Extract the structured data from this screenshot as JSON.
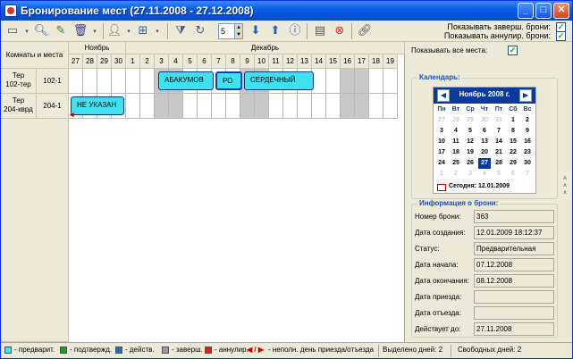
{
  "window": {
    "title": "Бронирование мест (27.11.2008 - 27.12.2008)"
  },
  "titlebar_buttons": {
    "minimize": "_",
    "maximize": "□",
    "close": "✕"
  },
  "toolbar": {
    "spin_value": "5",
    "options": {
      "show_completed": "Показывать заверш. брони:",
      "show_cancelled": "Показывать аннулир. брони:"
    }
  },
  "grid": {
    "rooms_header": "Комнаты и места",
    "months": [
      "Ноябрь",
      "Декабрь"
    ],
    "days": [
      "27",
      "28",
      "29",
      "30",
      "1",
      "2",
      "3",
      "4",
      "5",
      "6",
      "7",
      "8",
      "9",
      "10",
      "11",
      "12",
      "13",
      "14",
      "15",
      "16",
      "17",
      "18",
      "19"
    ],
    "rows": [
      {
        "room": "Тер\n102-тер",
        "place": "102-1"
      },
      {
        "room": "Тер\n204-кврд",
        "place": "204-1"
      }
    ],
    "bookings": [
      "АБАКУМОВ",
      "РО",
      "СЕРДЕЧНЫЙ",
      "НЕ УКАЗАН"
    ]
  },
  "side": {
    "show_all_label": "Показывать все места:",
    "calendar_title": "Календарь:",
    "calendar": {
      "month": "Ноябрь 2008 г.",
      "dow": [
        "Пн",
        "Вт",
        "Ср",
        "Чт",
        "Пт",
        "Сб",
        "Вс"
      ],
      "weeks": [
        [
          "27",
          "28",
          "29",
          "30",
          "31",
          "1",
          "2"
        ],
        [
          "3",
          "4",
          "5",
          "6",
          "7",
          "8",
          "9"
        ],
        [
          "10",
          "11",
          "12",
          "13",
          "14",
          "15",
          "16"
        ],
        [
          "17",
          "18",
          "19",
          "20",
          "21",
          "22",
          "23"
        ],
        [
          "24",
          "25",
          "26",
          "27",
          "28",
          "29",
          "30"
        ],
        [
          "1",
          "2",
          "3",
          "4",
          "5",
          "6",
          "7"
        ]
      ],
      "today": "Сегодня: 12.01.2009"
    },
    "info_title": "Информация о брони:",
    "info": [
      {
        "label": "Номер брони:",
        "value": "363"
      },
      {
        "label": "Дата создания:",
        "value": "12.01.2009 18:12:37"
      },
      {
        "label": "Статус:",
        "value": "Предварительная"
      },
      {
        "label": "Дата начала:",
        "value": "07.12.2008"
      },
      {
        "label": "Дата окончания:",
        "value": "08.12.2008"
      },
      {
        "label": "Дата приезда:",
        "value": ""
      },
      {
        "label": "Дата отъезда:",
        "value": ""
      },
      {
        "label": "Действует до:",
        "value": "27.11.2008"
      }
    ]
  },
  "status": {
    "legend": [
      {
        "text": "- предварит.",
        "color": "#3fe0f0"
      },
      {
        "text": "- подтвержд.",
        "color": "#1e9a1e"
      },
      {
        "text": "- действ.",
        "color": "#2f6fb5"
      },
      {
        "text": "- заверш.",
        "color": "#9a9a9a"
      },
      {
        "text": "- аннулир.",
        "color": "#d62020"
      }
    ],
    "partial_day": "- неполн. день приезда/отъезда",
    "selected_days": "Выделено дней:  2",
    "free_days": "Свободных дней:  2"
  }
}
